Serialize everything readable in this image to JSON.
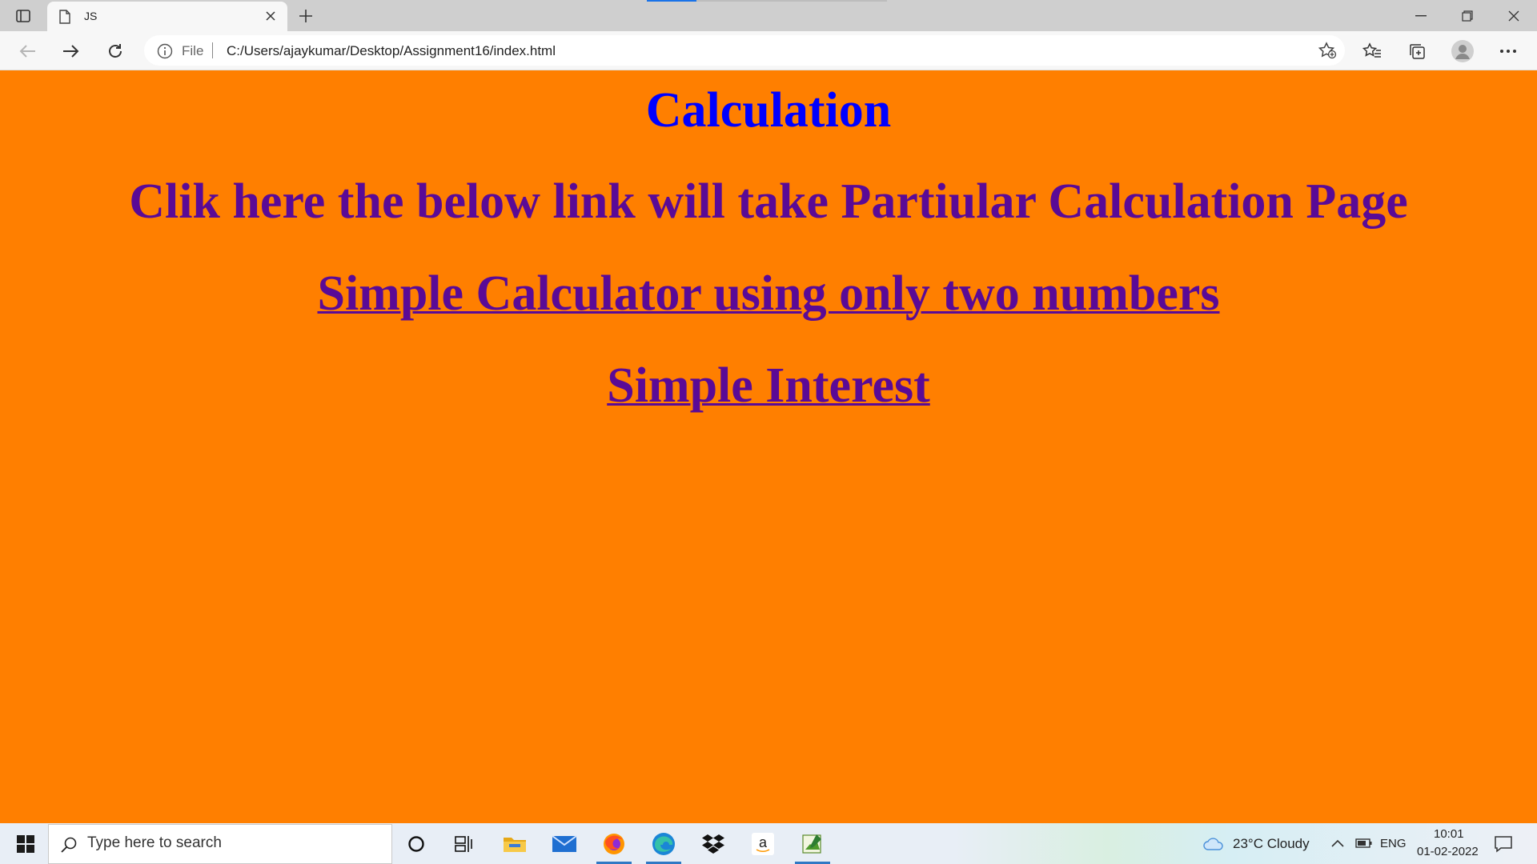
{
  "browser": {
    "tab_title": "JS",
    "address_scheme": "File",
    "address_url": "C:/Users/ajaykumar/Desktop/Assignment16/index.html"
  },
  "page": {
    "heading": "Calculation",
    "subheading": "Clik here the below link will take Partiular Calculation Page",
    "links": [
      "Simple Calculator using only two numbers",
      "Simple Interest"
    ],
    "background_color": "#ff7f00",
    "heading_color": "#0000ff",
    "link_color": "#5a0a96"
  },
  "taskbar": {
    "search_placeholder": "Type here to search",
    "weather": "23°C  Cloudy",
    "language": "ENG",
    "time": "10:01",
    "date": "01-02-2022",
    "pinned_apps": [
      "cortana-icon",
      "task-view-icon",
      "file-explorer-icon",
      "mail-icon",
      "firefox-icon",
      "edge-icon",
      "dropbox-icon",
      "amazon-icon",
      "notepad-icon"
    ]
  }
}
